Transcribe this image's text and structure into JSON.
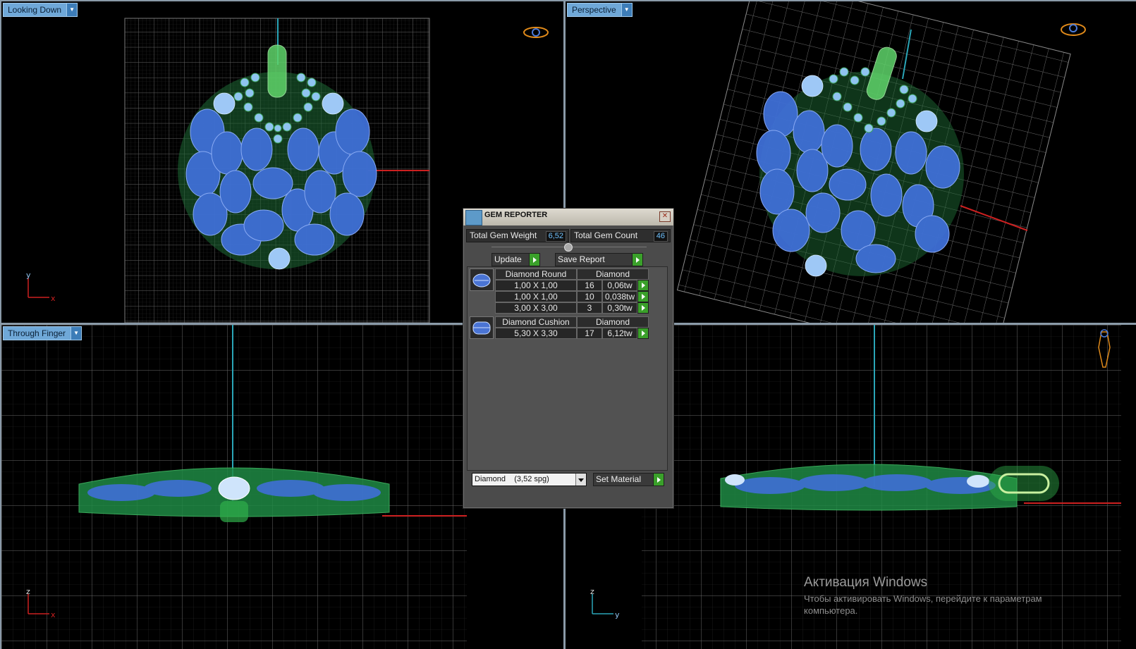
{
  "viewports": {
    "top_left": {
      "label": "Looking Down",
      "axis1": "y",
      "axis2": "x"
    },
    "top_right": {
      "label": "Perspective"
    },
    "bottom_left": {
      "label": "Through Finger",
      "axis1": "z",
      "axis2": "x"
    },
    "bottom_right": {
      "label": "",
      "axis1": "z",
      "axis2": "y"
    }
  },
  "gem_reporter": {
    "title": "GEM REPORTER",
    "total_weight_label": "Total Gem Weight",
    "total_weight_value": "6,52",
    "total_count_label": "Total Gem Count",
    "total_count_value": "46",
    "update_label": "Update",
    "save_report_label": "Save Report",
    "groups": [
      {
        "cut": "Diamond Round",
        "material": "Diamond",
        "rows": [
          {
            "size": "1,00 X 1,00",
            "count": "16",
            "weight": "0,06tw"
          },
          {
            "size": "1,00 X 1,00",
            "count": "10",
            "weight": "0,038tw"
          },
          {
            "size": "3,00 X 3,00",
            "count": "3",
            "weight": "0,30tw"
          }
        ]
      },
      {
        "cut": "Diamond Cushion",
        "material": "Diamond",
        "rows": [
          {
            "size": "5,30 X 3,30",
            "count": "17",
            "weight": "6,12tw"
          }
        ]
      }
    ],
    "material_select": "Diamond    (3,52 spg)",
    "set_material_label": "Set Material"
  },
  "watermark": {
    "title": "Активация Windows",
    "line1": "Чтобы активировать Windows, перейдите к параметрам",
    "line2": "компьютера."
  },
  "colors": {
    "gem_blue": "#3f6fd6",
    "metal_green": "#2fae4a",
    "grid": "#5a5a5a",
    "axis_red": "#cc2020",
    "axis_cyan": "#2aa6b8",
    "viewport_label": "#6fa8d8",
    "go_button": "#3aa02a"
  }
}
